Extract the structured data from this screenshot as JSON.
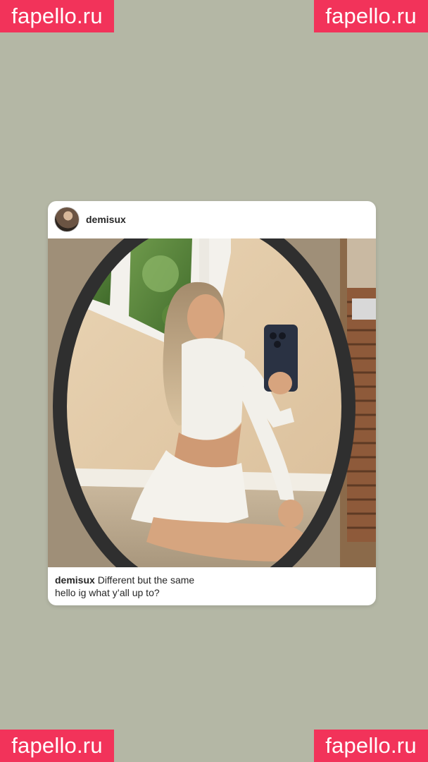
{
  "watermark": {
    "text": "fapello.ru",
    "color": "#f2335a"
  },
  "post": {
    "username": "demisux",
    "avatar_icon": "profile-avatar",
    "caption": {
      "username": "demisux",
      "line1": "Different but the same",
      "line2": "hello ig what y’all up to?"
    }
  },
  "colors": {
    "background": "#b4b7a5",
    "card": "#ffffff",
    "text": "#262626"
  }
}
